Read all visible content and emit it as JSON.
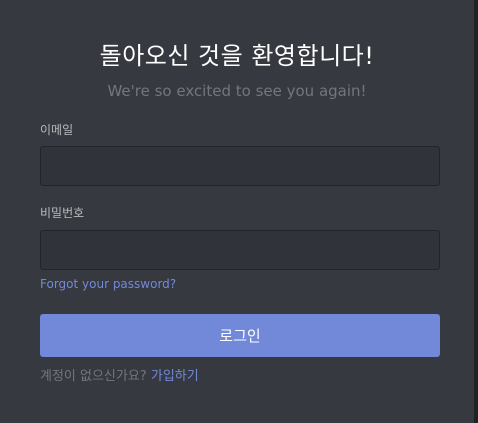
{
  "login": {
    "title": "돌아오신 것을 환영합니다!",
    "subtitle": "We're so excited to see you again!",
    "email_label": "이메일",
    "email_value": "",
    "password_label": "비밀번호",
    "password_value": "",
    "forgot_password": "Forgot your password?",
    "login_button": "로그인",
    "need_account": "계정이 없으신가요?",
    "register_link": "가입하기"
  },
  "colors": {
    "background": "#36393f",
    "input_background": "#303339",
    "accent": "#7289da",
    "muted_text": "#72767d",
    "label_text": "#b9bbbe"
  }
}
